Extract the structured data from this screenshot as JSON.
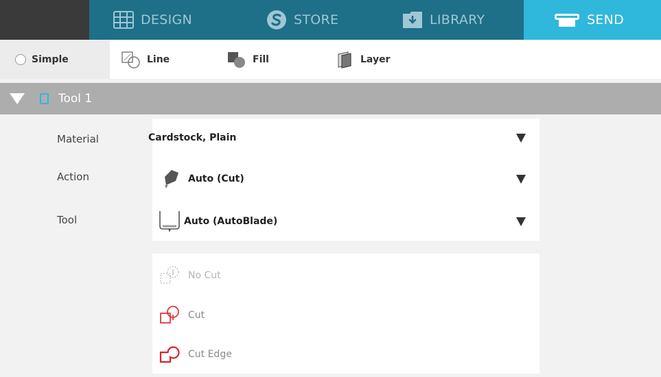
{
  "nav": {
    "tabs": [
      {
        "label": "DESIGN",
        "icon": "grid-icon"
      },
      {
        "label": "STORE",
        "icon": "store-s-icon"
      },
      {
        "label": "LIBRARY",
        "icon": "library-download-icon"
      },
      {
        "label": "SEND",
        "icon": "cutter-icon",
        "active": true
      }
    ]
  },
  "modes": {
    "simple": "Simple",
    "line": "Line",
    "fill": "Fill",
    "layer": "Layer"
  },
  "tool_panel": {
    "title": "Tool 1",
    "swatch_color": "#2fb7dc"
  },
  "settings": {
    "material_label": "Material",
    "material_value": "Cardstock, Plain",
    "action_label": "Action",
    "action_value": "Auto (Cut)",
    "tool_label": "Tool",
    "tool_value": "Auto (AutoBlade)"
  },
  "cut_options": [
    {
      "label": "No Cut",
      "color": "#b5b5b5"
    },
    {
      "label": "Cut",
      "color": "#d9232d"
    },
    {
      "label": "Cut Edge",
      "color": "#d9232d"
    }
  ],
  "colors": {
    "nav_bg": "#1e6f88",
    "nav_active": "#2fb7dc",
    "header_bg": "#adadad"
  }
}
